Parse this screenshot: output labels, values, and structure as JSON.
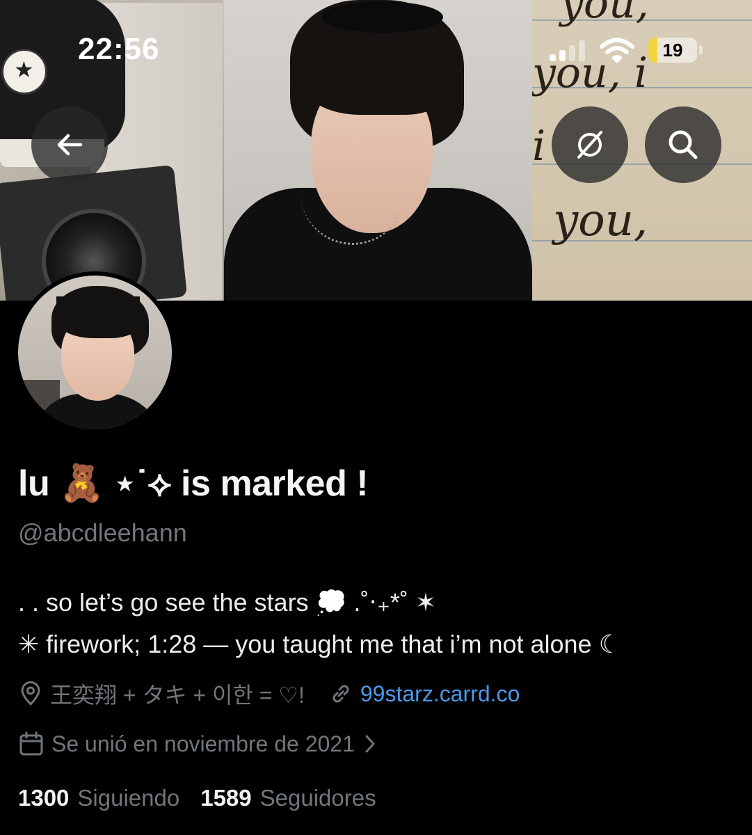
{
  "status_bar": {
    "time": "22:56",
    "battery_level": "19",
    "battery_fraction": 0.19
  },
  "banner": {
    "back_icon": "arrow-left-icon",
    "hide_icon": "eye-slash-circle-icon",
    "search_icon": "search-icon",
    "handwriting_words": [
      "you,",
      "you, i",
      "i",
      "you,"
    ]
  },
  "profile": {
    "display_name": "lu 🧸 ⋆˙⟡ is marked !",
    "handle": "@abcdleehann",
    "bio_line_1": ". . so let’s go see the stars 💭 .˚‧₊*˚ ✶",
    "bio_line_2": "✳ firework; 1:28 — you taught me that i’m not alone ☾",
    "location": "王奕翔 + タキ + 이한 = ♡!",
    "website": "99starz.carrd.co",
    "joined": "Se unió en noviembre de 2021",
    "following_count": "1300",
    "following_label": "Siguiendo",
    "followers_count": "1589",
    "followers_label": "Seguidores"
  },
  "colors": {
    "background": "#000000",
    "muted_text": "#71767b",
    "link": "#4a99e9",
    "battery_fill": "#f4d63c"
  }
}
